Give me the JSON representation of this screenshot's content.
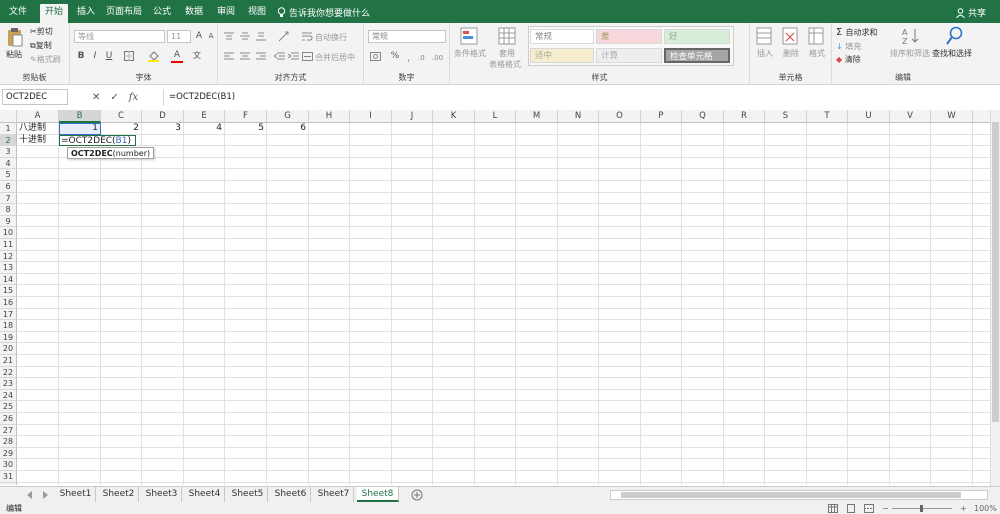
{
  "tabs": [
    {
      "label": "文件",
      "active": false
    },
    {
      "label": "开始",
      "active": true
    },
    {
      "label": "插入",
      "active": false
    },
    {
      "label": "页面布局",
      "active": false
    },
    {
      "label": "公式",
      "active": false
    },
    {
      "label": "数据",
      "active": false
    },
    {
      "label": "审阅",
      "active": false
    },
    {
      "label": "视图",
      "active": false
    }
  ],
  "tell_me": "告诉我你想要做什么",
  "share": "共享",
  "ribbon": {
    "clipboard": {
      "paste": "粘贴",
      "cut": "剪切",
      "copy": "复制",
      "format_painter": "格式刷",
      "label": "剪贴板"
    },
    "font": {
      "name": "等线",
      "size": "11",
      "bold": "B",
      "italic": "I",
      "underline": "U",
      "grow": "A",
      "shrink": "A",
      "label": "字体",
      "wen": "文"
    },
    "alignment": {
      "wrap": "自动换行",
      "merge": "合并后居中",
      "label": "对齐方式"
    },
    "number": {
      "format": "常规",
      "percent": "%",
      "label": "数字"
    },
    "styles": {
      "conditional": "条件格式",
      "table": "套用",
      "table2": "表格格式",
      "normal": "常规",
      "bad": "差",
      "good": "好",
      "neutral": "适中",
      "calc": "计算",
      "check": "检查单元格",
      "label": "样式"
    },
    "cells": {
      "insert": "插入",
      "delete": "删除",
      "format": "格式",
      "label": "单元格"
    },
    "editing": {
      "autosum": "自动求和",
      "fill": "填充",
      "clear": "清除",
      "sort": "排序和筛选",
      "find": "查找和选择",
      "label": "编辑"
    }
  },
  "formula_bar": {
    "name_box": "OCT2DEC",
    "formula": "=OCT2DEC(B1)"
  },
  "columns": [
    "A",
    "B",
    "C",
    "D",
    "E",
    "F",
    "G",
    "H",
    "I",
    "J",
    "K",
    "L",
    "M",
    "N",
    "O",
    "P",
    "Q",
    "R",
    "S",
    "T",
    "U",
    "V",
    "W"
  ],
  "rows": [
    "1",
    "2",
    "3",
    "4",
    "5",
    "6",
    "7",
    "8",
    "9",
    "10",
    "11",
    "12",
    "13",
    "14",
    "15",
    "16",
    "17",
    "18",
    "19",
    "20",
    "21",
    "22",
    "23",
    "24",
    "25",
    "26",
    "27",
    "28",
    "29",
    "30",
    "31",
    "32",
    "33"
  ],
  "cells": {
    "A1": "八进制",
    "A2": "十进制",
    "B1": "1",
    "C1": "2",
    "D1": "3",
    "E1": "4",
    "F1": "5",
    "G1": "6"
  },
  "editing_cell": {
    "prefix": "=OCT2DEC(",
    "ref": "B1",
    "suffix": ")"
  },
  "tooltip": {
    "fn": "OCT2DEC",
    "args": "(number)"
  },
  "sheets": [
    "Sheet1",
    "Sheet2",
    "Sheet3",
    "Sheet4",
    "Sheet5",
    "Sheet6",
    "Sheet7",
    "Sheet8"
  ],
  "active_sheet": "Sheet8",
  "status": {
    "mode": "编辑",
    "zoom": "100%"
  },
  "colors": {
    "accent": "#217346",
    "ref": "#3a6fc4"
  }
}
